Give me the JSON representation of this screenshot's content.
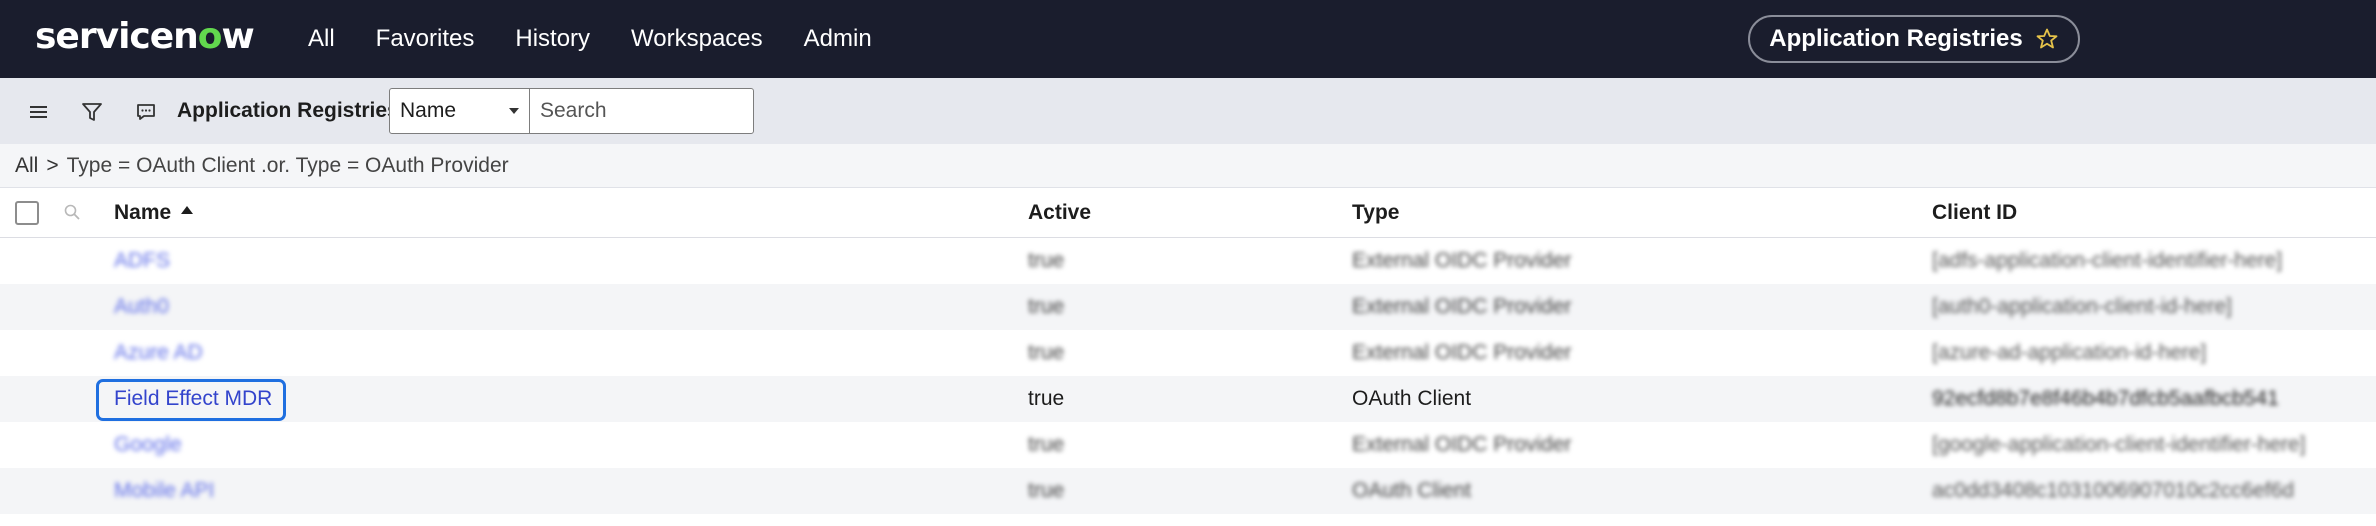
{
  "brand": {
    "logo_prefix": "servicen",
    "logo_o": "o",
    "logo_suffix": "w"
  },
  "nav": {
    "items": [
      "All",
      "Favorites",
      "History",
      "Workspaces",
      "Admin"
    ],
    "app_title": "Application Registries"
  },
  "toolbar": {
    "title": "Application Registries",
    "field_select": "Name",
    "search_placeholder": "Search"
  },
  "breadcrumb": {
    "root": "All",
    "separator": ">",
    "filter": "Type = OAuth Client .or. Type = OAuth Provider"
  },
  "table": {
    "columns": [
      "Name",
      "Active",
      "Type",
      "Client ID"
    ],
    "sort": {
      "column": "Name",
      "direction": "asc"
    },
    "rows": [
      {
        "name": "ADFS",
        "active": "true",
        "type": "External OIDC Provider",
        "client_id": "[adfs-application-client-identifier-here]"
      },
      {
        "name": "Auth0",
        "active": "true",
        "type": "External OIDC Provider",
        "client_id": "[auth0-application-client-id-here]"
      },
      {
        "name": "Azure AD",
        "active": "true",
        "type": "External OIDC Provider",
        "client_id": "[azure-ad-application-id-here]"
      },
      {
        "name": "Field Effect MDR",
        "active": "true",
        "type": "OAuth Client",
        "client_id": "92ecfd8b7e8f46b4b7dfcb5aafbcb541"
      },
      {
        "name": "Google",
        "active": "true",
        "type": "External OIDC Provider",
        "client_id": "[google-application-client-identifier-here]"
      },
      {
        "name": "Mobile API",
        "active": "true",
        "type": "OAuth Client",
        "client_id": "ac0dd3408c1031006907010c2cc6ef6d"
      }
    ]
  },
  "colors": {
    "nav_bg": "#1a1d2d",
    "accent_green": "#62d84e",
    "link": "#3c4bd8",
    "focus": "#1f6fe0"
  }
}
